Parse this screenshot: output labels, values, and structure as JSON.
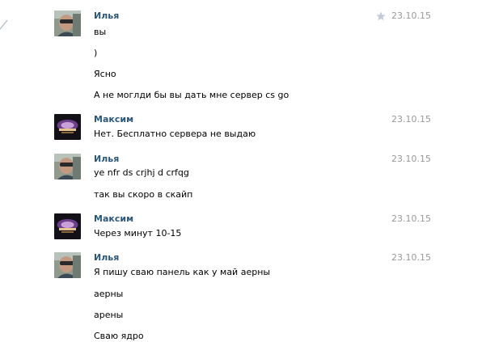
{
  "colors": {
    "author": "#2b587a",
    "date": "#999999",
    "text": "#000000",
    "star": "#c3cbd4",
    "background": "#ffffff"
  },
  "messages": [
    {
      "author": "Илья",
      "date": "23.10.15",
      "avatar": "photo-man-sunglasses",
      "starred_icon": "star-icon",
      "lines": [
        "вы",
        ")",
        "Ясно",
        "А не моглди бы вы дать мне сервер cs go"
      ]
    },
    {
      "author": "Максим",
      "date": "23.10.15",
      "avatar": "dark-game-emblem",
      "lines": [
        "Нет. Бесплатно сервера не выдаю"
      ]
    },
    {
      "author": "Илья",
      "date": "23.10.15",
      "avatar": "photo-man-sunglasses",
      "lines": [
        "ye nfr ds crjhj d crfqg",
        "так вы скоро в скайп"
      ]
    },
    {
      "author": "Максим",
      "date": "23.10.15",
      "avatar": "dark-game-emblem",
      "lines": [
        "Через минут 10-15"
      ]
    },
    {
      "author": "Илья",
      "date": "23.10.15",
      "avatar": "photo-man-sunglasses",
      "lines": [
        "Я пишу сваю панель как у май аерны",
        "аерны",
        "арены",
        "Сваю ядро"
      ]
    }
  ]
}
